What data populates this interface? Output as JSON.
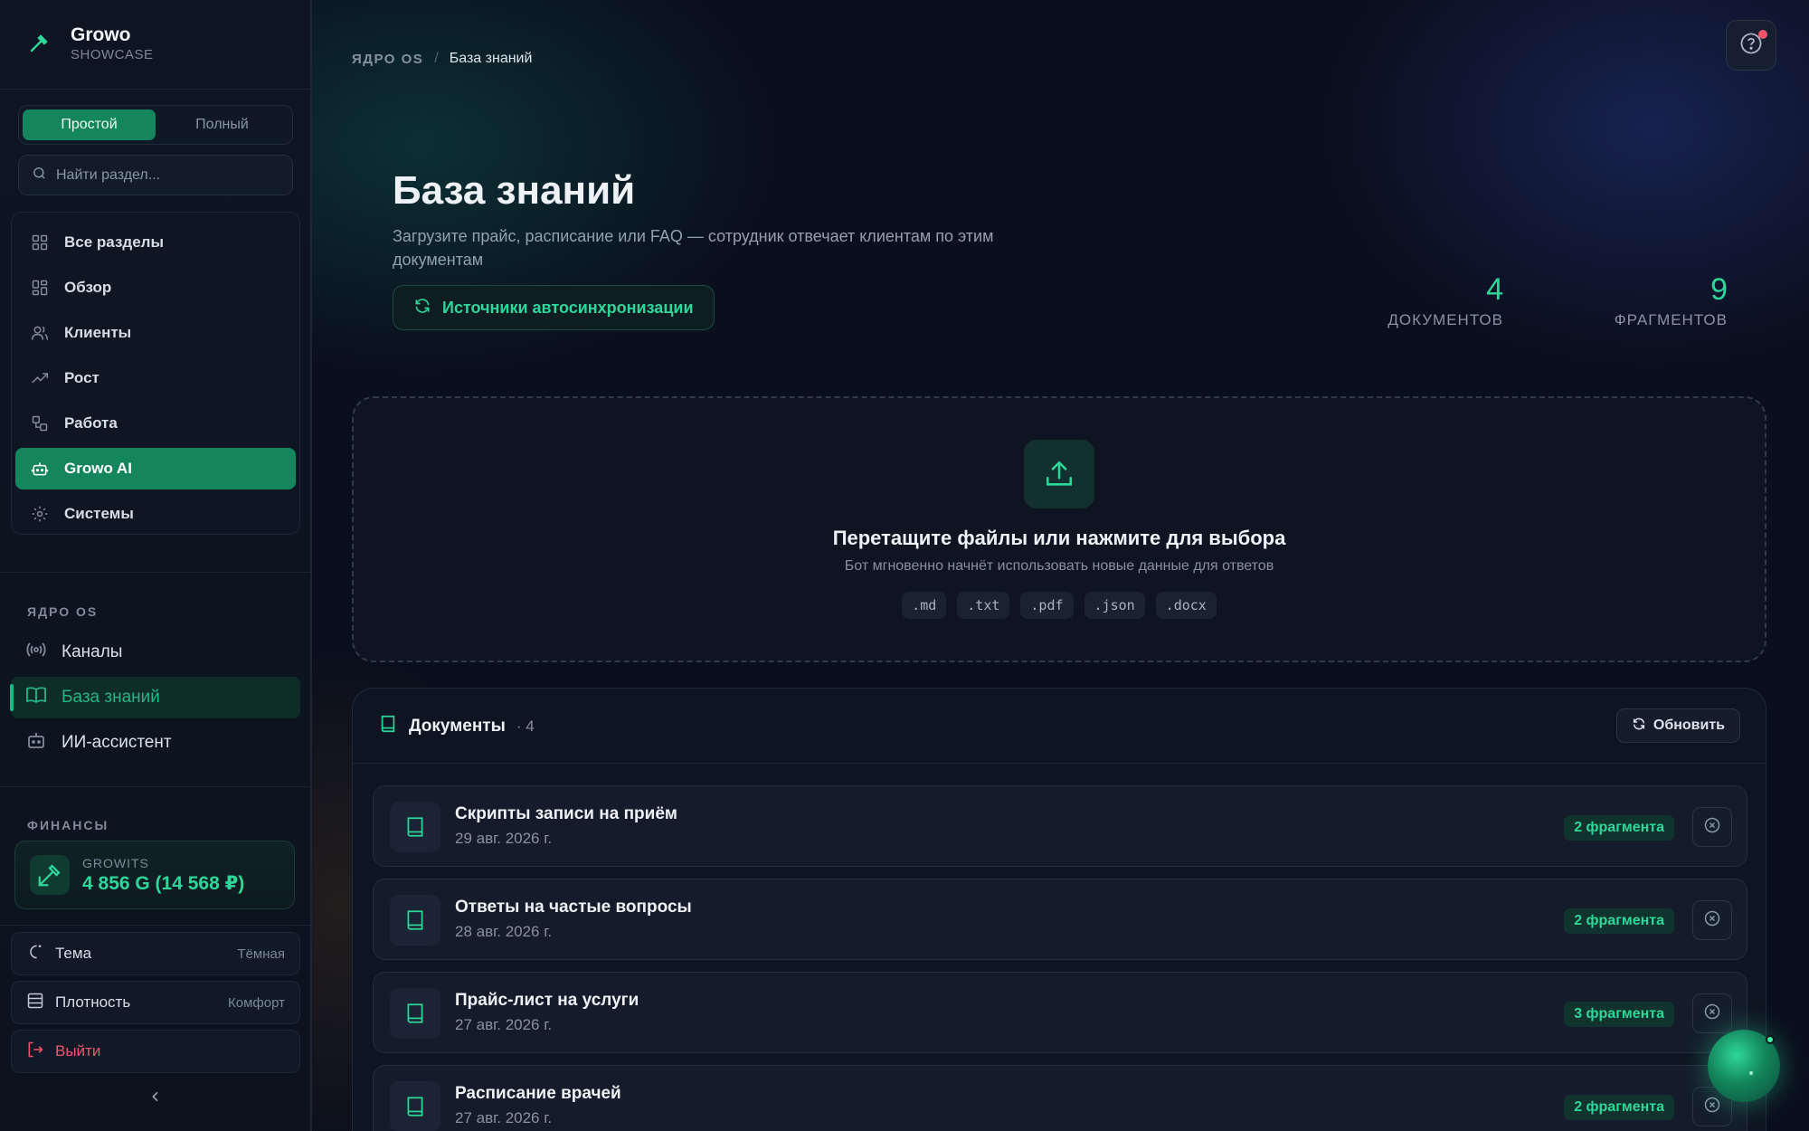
{
  "brand": {
    "name": "Growo",
    "subtitle": "SHOWCASE"
  },
  "mode_switch": {
    "simple": "Простой",
    "full": "Полный",
    "active": "simple"
  },
  "search": {
    "placeholder": "Найти раздел..."
  },
  "nav": {
    "items": [
      {
        "label": "Все разделы",
        "icon": "grid-icon"
      },
      {
        "label": "Обзор",
        "icon": "dashboard-icon"
      },
      {
        "label": "Клиенты",
        "icon": "users-icon"
      },
      {
        "label": "Рост",
        "icon": "trending-up-icon"
      },
      {
        "label": "Работа",
        "icon": "workflow-icon"
      },
      {
        "label": "Growo AI",
        "icon": "bot-icon",
        "active": true
      },
      {
        "label": "Системы",
        "icon": "gear-icon"
      }
    ]
  },
  "core_section": {
    "title": "ЯДРО OS",
    "items": [
      {
        "label": "Каналы",
        "icon": "broadcast-icon"
      },
      {
        "label": "База знаний",
        "icon": "book-open-icon",
        "active": true
      },
      {
        "label": "ИИ-ассистент",
        "icon": "bot-icon"
      }
    ]
  },
  "finance_section": {
    "title": "ФИНАНСЫ",
    "card": {
      "label": "GROWITS",
      "value": "4 856 G (14 568 ₽)"
    }
  },
  "settings": {
    "theme": {
      "label": "Тема",
      "value": "Тёмная"
    },
    "density": {
      "label": "Плотность",
      "value": "Комфорт"
    },
    "logout": {
      "label": "Выйти"
    }
  },
  "breadcrumb": {
    "root": "ЯДРО OS",
    "separator": "/",
    "current": "База знаний"
  },
  "header": {
    "title": "База знаний",
    "description": "Загрузите прайс, расписание или FAQ — сотрудник отвечает клиентам по этим документам",
    "sync_button": "Источники автосинхронизации"
  },
  "stats": [
    {
      "value": "4",
      "label": "ДОКУМЕНТОВ"
    },
    {
      "value": "9",
      "label": "ФРАГМЕНТОВ"
    }
  ],
  "dropzone": {
    "title": "Перетащите файлы или нажмите для выбора",
    "subtitle": "Бот мгновенно начнёт использовать новые данные для ответов",
    "extensions": [
      ".md",
      ".txt",
      ".pdf",
      ".json",
      ".docx"
    ]
  },
  "documents": {
    "title": "Документы",
    "count": "· 4",
    "refresh": "Обновить",
    "rows": [
      {
        "name": "Скрипты записи на приём",
        "date": "29 авг. 2026 г.",
        "fragments": "2 фрагмента"
      },
      {
        "name": "Ответы на частые вопросы",
        "date": "28 авг. 2026 г.",
        "fragments": "2 фрагмента"
      },
      {
        "name": "Прайс-лист на услуги",
        "date": "27 авг. 2026 г.",
        "fragments": "3 фрагмента"
      },
      {
        "name": "Расписание врачей",
        "date": "27 авг. 2026 г.",
        "fragments": "2 фрагмента"
      }
    ]
  },
  "colors": {
    "accent": "#14855c",
    "accent_text": "#2fd69a",
    "danger": "#f0566b",
    "background": "#0a0f1d"
  }
}
